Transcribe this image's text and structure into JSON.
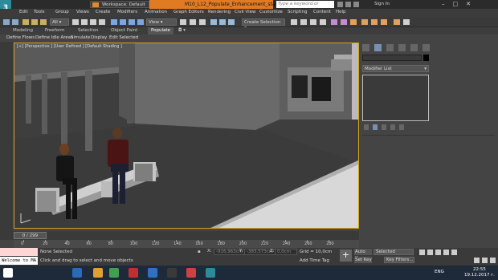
{
  "app": {
    "icon_text": "3",
    "workspace": "Workspace: Default",
    "title": "M10_L12_Populate_Enhancement_start.max",
    "search_placeholder": "Type a keyword or phrase",
    "sign_in": "Sign In"
  },
  "menu": [
    "Edit",
    "Tools",
    "Group",
    "Views",
    "Create",
    "Modifiers",
    "Animation",
    "Graph Editors",
    "Rendering",
    "Civil View",
    "Customize",
    "Scripting",
    "Content",
    "Help"
  ],
  "toolbar": {
    "view_select": "View",
    "selection_set": "Create Selection Se"
  },
  "ribbon_tabs": [
    {
      "label": "Modeling",
      "active": false
    },
    {
      "label": "Freeform",
      "active": false
    },
    {
      "label": "Selection",
      "active": false
    },
    {
      "label": "Object Paint",
      "active": false
    },
    {
      "label": "Populate",
      "active": true
    }
  ],
  "ribbon_sub": [
    "Define Flows",
    "Define Idle Areas",
    "Simulate",
    "Display",
    "Edit Selected"
  ],
  "viewport": {
    "label": "[+] [Perspective ] [User Defined ] [Default Shading ]"
  },
  "panel": {
    "modifier_list": "Modifier List"
  },
  "timeline": {
    "frame": "0 / 299",
    "ticks": [
      0,
      20,
      40,
      60,
      80,
      100,
      120,
      140,
      160,
      180,
      200,
      220,
      240,
      260,
      280
    ]
  },
  "status": {
    "selection": "None Selected",
    "hint": "Click and drag to select and move objects",
    "maxscript": "Welcome to MA",
    "x_label": "X:",
    "x_value": "-916,963cm",
    "y_label": "Y:",
    "y_value": "-383,573cm",
    "z_label": "Z:",
    "z_value": "0,0cm",
    "grid": "Grid = 10,0cm",
    "add_time_tag": "Add Time Tag",
    "auto_key": "Auto Key",
    "set_key": "Set Key",
    "key_mode": "Selected",
    "key_filters": "Key Filters..."
  },
  "taskbar": {
    "lang": "ENG",
    "time": "22:55",
    "date": "19.12.2017 г."
  }
}
